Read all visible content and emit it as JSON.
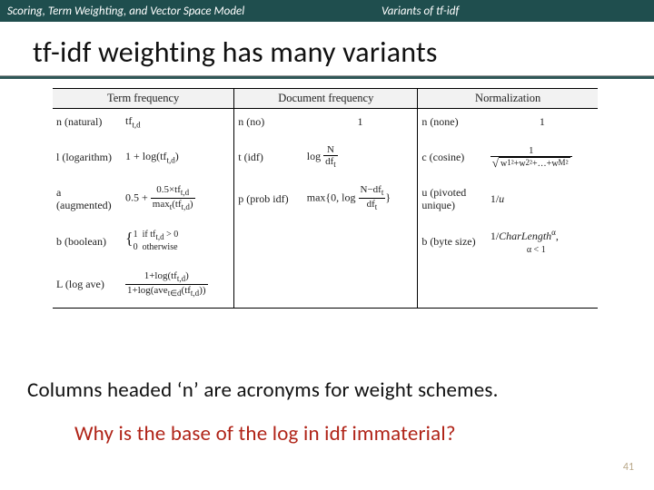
{
  "header": {
    "left": "Scoring, Term Weighting, and Vector Space Model",
    "right": "Variants of tf-idf"
  },
  "title": "tf-idf weighting has many variants",
  "columns": {
    "tf": "Term frequency",
    "df": "Document frequency",
    "norm": "Normalization"
  },
  "rows": {
    "r1": {
      "tf_lbl": "n (natural)",
      "tf_f": "tf_t,d",
      "df_lbl": "n (no)",
      "df_f": "1",
      "nm_lbl": "n (none)",
      "nm_f": "1"
    },
    "r2": {
      "tf_lbl": "l (logarithm)",
      "tf_f": "1 + log(tf_t,d)",
      "df_lbl": "t (idf)",
      "df_f_num": "N",
      "df_f_den": "df_t",
      "nm_lbl": "c (cosine)",
      "nm_rad": "w₁²+w₂²+…+w_M²"
    },
    "r3": {
      "tf_lbl": "a (augmented)",
      "tf_pre": "0.5 + ",
      "tf_num": "0.5×tf_t,d",
      "tf_den": "max_t(tf_t,d)",
      "df_lbl": "p (prob idf)",
      "df_pre": "max{0, log ",
      "df_num": "N−df_t",
      "df_den": "df_t",
      "df_post": "}",
      "nm_lbl": "u (pivoted unique)",
      "nm_f": "1/u"
    },
    "r4": {
      "tf_lbl": "b (boolean)",
      "tf_top": "1   if tf_t,d > 0",
      "tf_bot": "0   otherwise",
      "df_lbl": "",
      "df_f": "",
      "nm_lbl": "b (byte size)",
      "nm_f": "1/CharLengthᵅ,",
      "nm_sub": "α < 1"
    },
    "r5": {
      "tf_lbl": "L (log ave)",
      "tf_num": "1+log(tf_t,d)",
      "tf_den": "1+log(ave_t∈d(tf_t,d))",
      "df_lbl": "",
      "df_f": "",
      "nm_lbl": "",
      "nm_f": ""
    }
  },
  "note1": "Columns headed ‘n’ are acronyms for weight schemes.",
  "note2": "Why is the base of the log in idf immaterial?",
  "page": "41"
}
